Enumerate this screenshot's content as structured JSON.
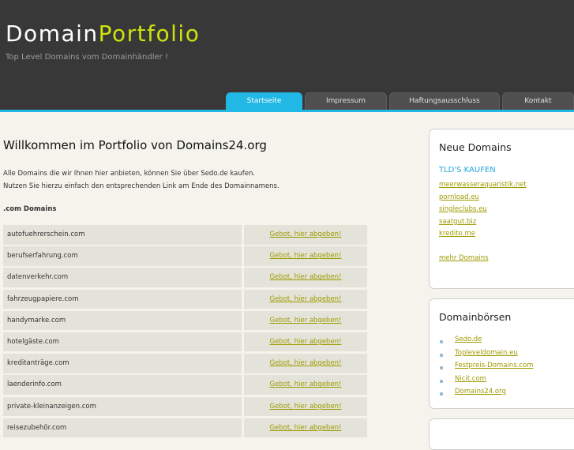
{
  "header": {
    "logo_part1": "Domain",
    "logo_part2": "Portfolio",
    "tagline": "Top Level Domains vom Domainhändler !"
  },
  "nav": {
    "tabs": [
      {
        "label": "Startseite",
        "active": true
      },
      {
        "label": "Impressum",
        "active": false
      },
      {
        "label": "Haftungsausschluss",
        "active": false
      },
      {
        "label": "Kontakt",
        "active": false
      }
    ]
  },
  "main": {
    "title": "Willkommen im Portfolio von Domains24.org",
    "intro_line1": "Alle Domains die wir Ihnen hier anbieten, können Sie über Sedo.de kaufen.",
    "intro_line2": "Nutzen Sie hierzu einfach den entsprechenden Link am Ende des Domainnamens.",
    "section_title": ".com Domains",
    "domains": [
      {
        "name": "autofuehrerschein.com",
        "link": "Gebot, hier abgeben!"
      },
      {
        "name": "berufserfahrung.com",
        "link": "Gebot, hier abgeben!"
      },
      {
        "name": "datenverkehr.com",
        "link": "Gebot, hier abgeben!"
      },
      {
        "name": "fahrzeugpapiere.com",
        "link": "Gebot, hier abgeben!"
      },
      {
        "name": "handymarke.com",
        "link": "Gebot, hier abgeben!"
      },
      {
        "name": "hotelgäste.com",
        "link": "Gebot, hier abgeben!"
      },
      {
        "name": "kreditanträge.com",
        "link": "Gebot, hier abgeben!"
      },
      {
        "name": "laenderinfo.com",
        "link": "Gebot, hier abgeben!"
      },
      {
        "name": "private-kleinanzeigen.com",
        "link": "Gebot, hier abgeben!"
      },
      {
        "name": "reisezubehör.com",
        "link": "Gebot, hier abgeben!"
      }
    ]
  },
  "sidebar": {
    "neue_domains": {
      "title": "Neue Domains",
      "subtitle": "TLD'S KAUFEN",
      "links": [
        "meerwasseraquaristik.net",
        "pornload.eu",
        "singleclubs.eu",
        "saatgut.biz",
        "kredite.me"
      ],
      "more": "mehr Domains"
    },
    "domainboersen": {
      "title": "Domainbörsen",
      "links": [
        "Sedo.de",
        "Topleveldomain.eu",
        "Festpreis-Domains.com",
        "Nicit.com",
        "Domains24.org"
      ]
    }
  }
}
